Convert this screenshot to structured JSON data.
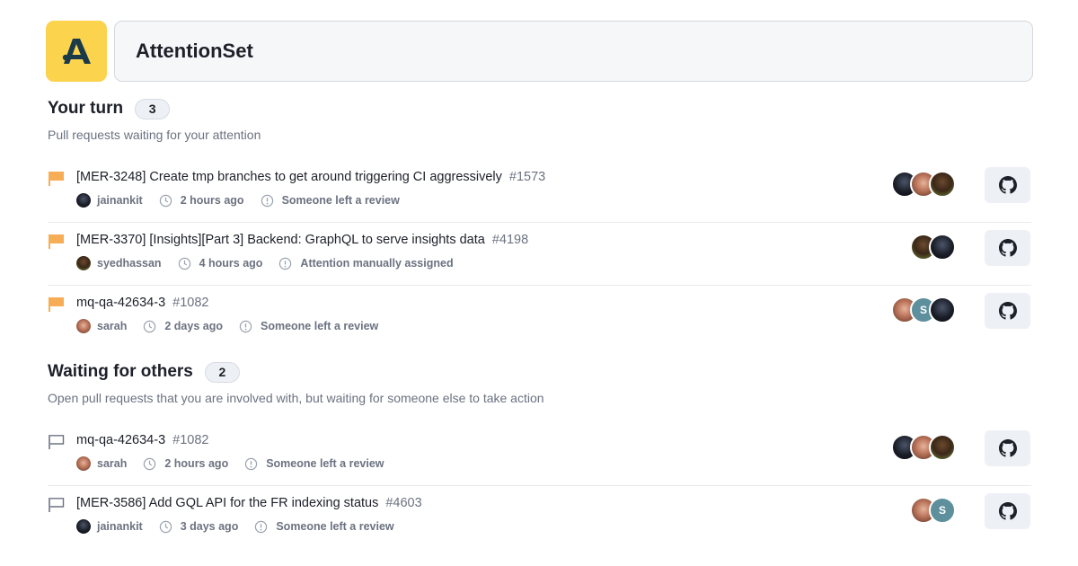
{
  "app": {
    "title": "AttentionSet"
  },
  "sections": [
    {
      "title": "Your turn",
      "count": "3",
      "description": "Pull requests waiting for your attention",
      "prs": [
        {
          "title": "[MER-3248] Create tmp branches to get around triggering CI aggressively",
          "number": "#1573",
          "author": "jainankit",
          "time": "2 hours ago",
          "reason": "Someone left a review",
          "flag": "filled",
          "reviewers": [
            "dark-avatar",
            "woman-avatar",
            "man-avatar"
          ]
        },
        {
          "title": "[MER-3370] [Insights][Part 3] Backend: GraphQL to serve insights data",
          "number": "#4198",
          "author": "syedhassan",
          "time": "4 hours ago",
          "reason": "Attention manually assigned",
          "flag": "filled",
          "reviewers": [
            "man-avatar",
            "dark-avatar"
          ]
        },
        {
          "title": "mq-qa-42634-3",
          "number": "#1082",
          "author": "sarah",
          "time": "2 days ago",
          "reason": "Someone left a review",
          "flag": "filled",
          "reviewers": [
            "woman-avatar",
            "S",
            "dark-avatar"
          ]
        }
      ]
    },
    {
      "title": "Waiting for others",
      "count": "2",
      "description": "Open pull requests that you are involved with, but waiting for someone else to take action",
      "prs": [
        {
          "title": "mq-qa-42634-3",
          "number": "#1082",
          "author": "sarah",
          "time": "2 hours ago",
          "reason": "Someone left a review",
          "flag": "outline",
          "reviewers": [
            "dark-avatar",
            "woman-avatar",
            "man-avatar"
          ]
        },
        {
          "title": "[MER-3586] Add GQL API for the FR indexing status",
          "number": "#4603",
          "author": "jainankit",
          "time": "3 days ago",
          "reason": "Someone left a review",
          "flag": "outline",
          "reviewers": [
            "woman-avatar",
            "S"
          ]
        }
      ]
    }
  ],
  "colors": {
    "accent": "#fcd34d",
    "flag_filled": "#f6ad55",
    "muted": "#6b7280",
    "avatar_s": "#5e8f9c"
  },
  "icons": {
    "logo": "attentionset-logo",
    "clock": "clock-icon",
    "alert": "alert-circle-icon",
    "github": "github-icon",
    "flag": "flag-icon"
  }
}
